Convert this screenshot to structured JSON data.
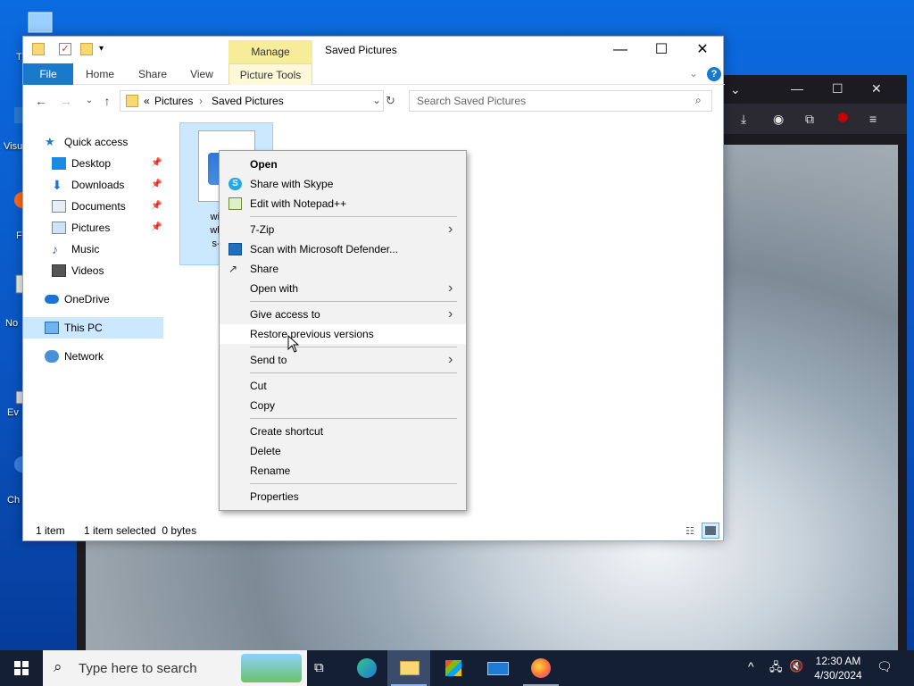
{
  "desktop": {
    "icons": [
      {
        "name": "recycle-bin",
        "label": "T"
      },
      {
        "name": "vscode",
        "label": "Visu"
      },
      {
        "name": "firefox",
        "label": "F"
      },
      {
        "name": "notepad",
        "label": "No"
      },
      {
        "name": "event-viewer",
        "label": "Ev"
      },
      {
        "name": "chrome",
        "label": "Ch"
      }
    ]
  },
  "explorer": {
    "title": "Saved Pictures",
    "manage_tab": "Manage",
    "ribbon_tabs": {
      "file": "File",
      "home": "Home",
      "share": "Share",
      "view": "View",
      "picture_tools": "Picture Tools"
    },
    "address": {
      "overflow": "«",
      "segments": [
        "Pictures",
        "Saved Pictures"
      ]
    },
    "search_placeholder": "Search Saved Pictures",
    "nav": {
      "quick_access": "Quick access",
      "desktop": "Desktop",
      "downloads": "Downloads",
      "documents": "Documents",
      "pictures": "Pictures",
      "music": "Music",
      "videos": "Videos",
      "onedrive": "OneDrive",
      "this_pc": "This PC",
      "network": "Network"
    },
    "file": {
      "name_lines": [
        "window",
        "white-w",
        "s-px1n",
        "y"
      ]
    },
    "status": {
      "count": "1 item",
      "selection": "1 item selected  0 bytes"
    }
  },
  "context_menu": {
    "open": "Open",
    "share_skype": "Share with Skype",
    "edit_notepad": "Edit with Notepad++",
    "seven_zip": "7-Zip",
    "defender": "Scan with Microsoft Defender...",
    "share": "Share",
    "open_with": "Open with",
    "give_access": "Give access to",
    "restore": "Restore previous versions",
    "send_to": "Send to",
    "cut": "Cut",
    "copy": "Copy",
    "create_shortcut": "Create shortcut",
    "delete": "Delete",
    "rename": "Rename",
    "properties": "Properties"
  },
  "taskbar": {
    "search_placeholder": "Type here to search",
    "time": "12:30 AM",
    "date": "4/30/2024"
  },
  "colors": {
    "accent": "#1979ca",
    "selection": "#cce8ff",
    "manage": "#f7ec9a",
    "taskbar": "#141f33"
  }
}
